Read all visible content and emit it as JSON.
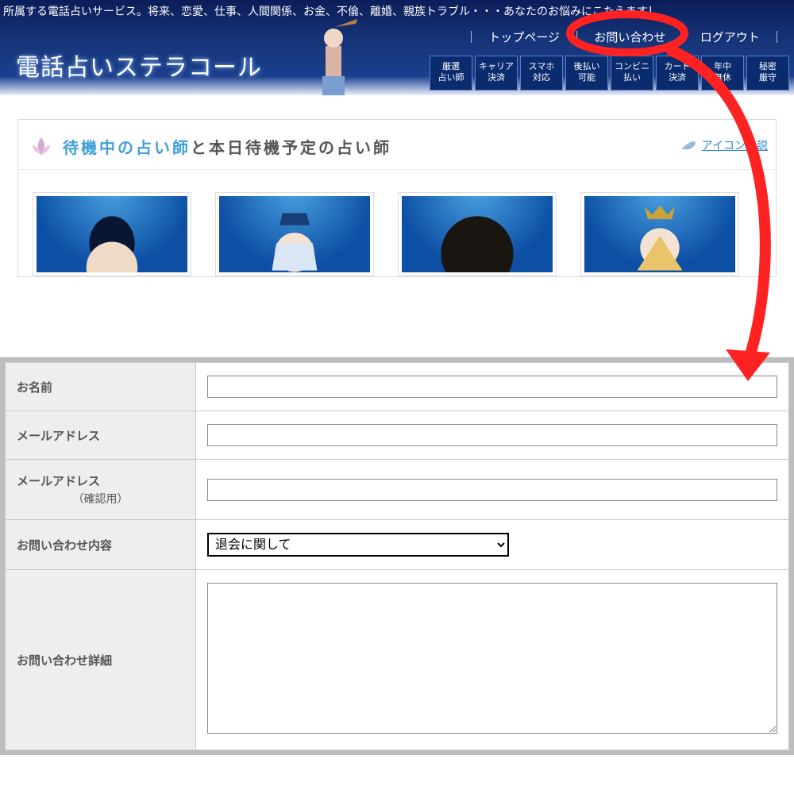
{
  "tagline": "所属する電話占いサービス。将来、恋愛、仕事、人間関係、お金、不倫、離婚、親族トラブル・・・あなたのお悩みにこたえます！",
  "nav": {
    "sep": "｜",
    "top": "トップページ",
    "contact": "お問い合わせ",
    "logout": "ログアウト"
  },
  "site_title": "電話占いステラコール",
  "badges": [
    "厳選\n占い師",
    "キャリア\n決済",
    "スマホ\n対応",
    "後払い\n可能",
    "コンビニ\n払い",
    "カード\n決済",
    "年中\n無休",
    "秘密\n厳守"
  ],
  "section": {
    "title_strong": "待機中の占い師",
    "title_rest": "と本日待機予定の占い師",
    "legend": "アイコンの説"
  },
  "form": {
    "name_label": "お名前",
    "email_label": "メールアドレス",
    "email_confirm_label": "メールアドレス",
    "email_confirm_sub": "（確認用）",
    "subject_label": "お問い合わせ内容",
    "subject_value": "退会に関して",
    "detail_label": "お問い合わせ詳細"
  }
}
